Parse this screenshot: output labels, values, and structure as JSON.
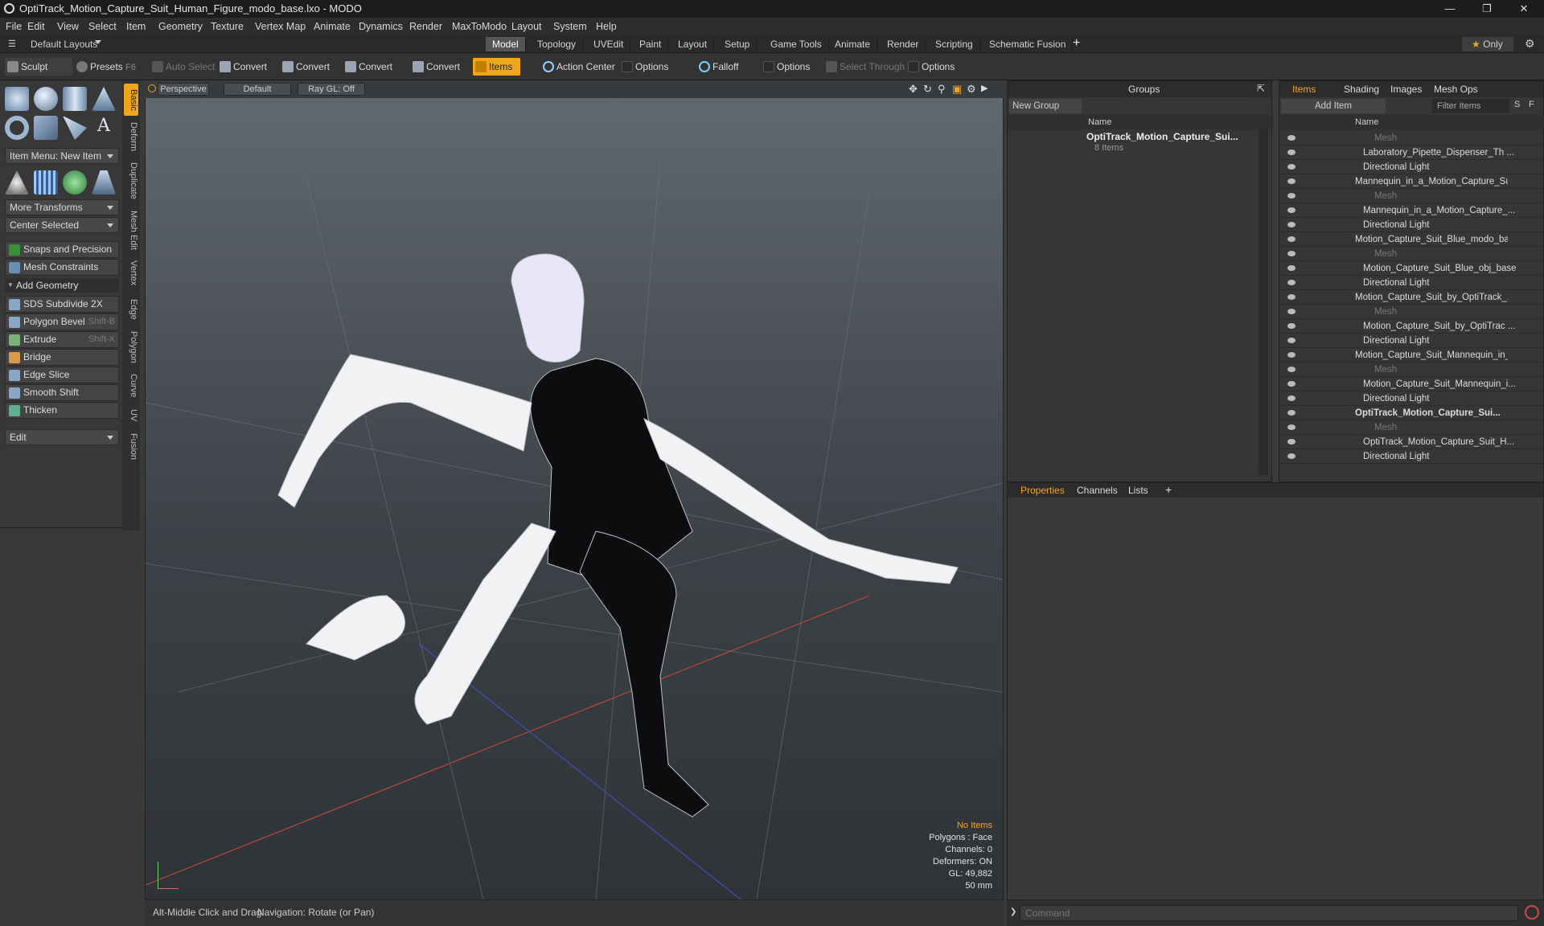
{
  "window": {
    "title": "OptiTrack_Motion_Capture_Suit_Human_Figure_modo_base.lxo - MODO"
  },
  "menu": [
    "File",
    "Edit",
    "View",
    "Select",
    "Item",
    "Geometry",
    "Texture",
    "Vertex Map",
    "Animate",
    "Dynamics",
    "Render",
    "MaxToModo",
    "Layout",
    "System",
    "Help"
  ],
  "layout_tabs": {
    "default_layouts": "Default Layouts",
    "tabs": [
      "Model",
      "Topology",
      "UVEdit",
      "Paint",
      "Layout",
      "Setup",
      "Game Tools",
      "Animate",
      "Render",
      "Scripting",
      "Schematic Fusion"
    ],
    "active": "Model",
    "only": "Only"
  },
  "toolbar": {
    "sculpt": "Sculpt",
    "presets": "Presets",
    "presets_key": "F6",
    "auto_select": "Auto Select",
    "convert": "Convert",
    "items": "Items",
    "action_center": "Action Center",
    "options": "Options",
    "falloff": "Falloff",
    "select_through": "Select Through"
  },
  "left": {
    "item_menu": "Item Menu: New Item",
    "more_transforms": "More Transforms",
    "center_selected": "Center Selected",
    "snaps": "Snaps and Precision",
    "mesh_constraints": "Mesh Constraints",
    "add_geometry": "Add Geometry",
    "tools": [
      {
        "label": "SDS Subdivide 2X",
        "key": ""
      },
      {
        "label": "Polygon Bevel",
        "key": "Shift-B"
      },
      {
        "label": "Extrude",
        "key": "Shift-X"
      },
      {
        "label": "Bridge",
        "key": ""
      },
      {
        "label": "Edge Slice",
        "key": ""
      },
      {
        "label": "Smooth Shift",
        "key": ""
      },
      {
        "label": "Thicken",
        "key": ""
      }
    ],
    "edit": "Edit",
    "vtabs": [
      "Basic",
      "Deform",
      "Duplicate",
      "Mesh Edit",
      "Vertex",
      "Edge",
      "Polygon",
      "Curve",
      "UV",
      "Fusion"
    ]
  },
  "viewport": {
    "view": "Perspective",
    "shading": "Default",
    "raygl": "Ray GL: Off",
    "hud": {
      "sel": "No Items",
      "polys": "Polygons : Face",
      "channels": "Channels: 0",
      "deformers": "Deformers: ON",
      "gl": "GL: 49,882",
      "lens": "50 mm"
    }
  },
  "status": {
    "hint": "Alt-Middle Click and Drag:",
    "nav": "Navigation: Rotate (or Pan)"
  },
  "groups": {
    "title": "Groups",
    "new_group": "New Group",
    "col_name": "Name",
    "group_name": "OptiTrack_Motion_Capture_Sui...",
    "group_count": "8 Items"
  },
  "items_panel": {
    "tabs": [
      "Items",
      "Shading",
      "Images",
      "Mesh Ops"
    ],
    "add_item": "Add Item",
    "filter": "Filter Items",
    "s": "S",
    "f": "F",
    "col_name": "Name",
    "rows": [
      {
        "t": "Mesh",
        "lvl": 2,
        "k": "mesh"
      },
      {
        "t": "Laboratory_Pipette_Dispenser_Th ...",
        "lvl": 1,
        "k": "obj"
      },
      {
        "t": "Directional Light",
        "lvl": 1,
        "k": "light"
      },
      {
        "t": "Mannequin_in_a_Motion_Capture_Su...",
        "lvl": 0,
        "k": "scene"
      },
      {
        "t": "Mesh",
        "lvl": 2,
        "k": "mesh"
      },
      {
        "t": "Mannequin_in_a_Motion_Capture_...",
        "lvl": 1,
        "k": "obj"
      },
      {
        "t": "Directional Light",
        "lvl": 1,
        "k": "light"
      },
      {
        "t": "Motion_Capture_Suit_Blue_modo_ba ...",
        "lvl": 0,
        "k": "scene"
      },
      {
        "t": "Mesh",
        "lvl": 2,
        "k": "mesh"
      },
      {
        "t": "Motion_Capture_Suit_Blue_obj_base",
        "lvl": 1,
        "k": "obj"
      },
      {
        "t": "Directional Light",
        "lvl": 1,
        "k": "light"
      },
      {
        "t": "Motion_Capture_Suit_by_OptiTrack_...",
        "lvl": 0,
        "k": "scene"
      },
      {
        "t": "Mesh",
        "lvl": 2,
        "k": "mesh"
      },
      {
        "t": "Motion_Capture_Suit_by_OptiTrac ...",
        "lvl": 1,
        "k": "obj"
      },
      {
        "t": "Directional Light",
        "lvl": 1,
        "k": "light"
      },
      {
        "t": "Motion_Capture_Suit_Mannequin_in_...",
        "lvl": 0,
        "k": "scene"
      },
      {
        "t": "Mesh",
        "lvl": 2,
        "k": "mesh"
      },
      {
        "t": "Motion_Capture_Suit_Mannequin_i...",
        "lvl": 1,
        "k": "obj"
      },
      {
        "t": "Directional Light",
        "lvl": 1,
        "k": "light"
      },
      {
        "t": "OptiTrack_Motion_Capture_Sui...",
        "lvl": 0,
        "k": "scene",
        "bold": true
      },
      {
        "t": "Mesh",
        "lvl": 2,
        "k": "mesh"
      },
      {
        "t": "OptiTrack_Motion_Capture_Suit_H...",
        "lvl": 1,
        "k": "obj"
      },
      {
        "t": "Directional Light",
        "lvl": 1,
        "k": "light"
      }
    ]
  },
  "props_tabs": [
    "Properties",
    "Channels",
    "Lists"
  ],
  "command": {
    "placeholder": "Command"
  },
  "colors": {
    "accent": "#f1a51d"
  }
}
